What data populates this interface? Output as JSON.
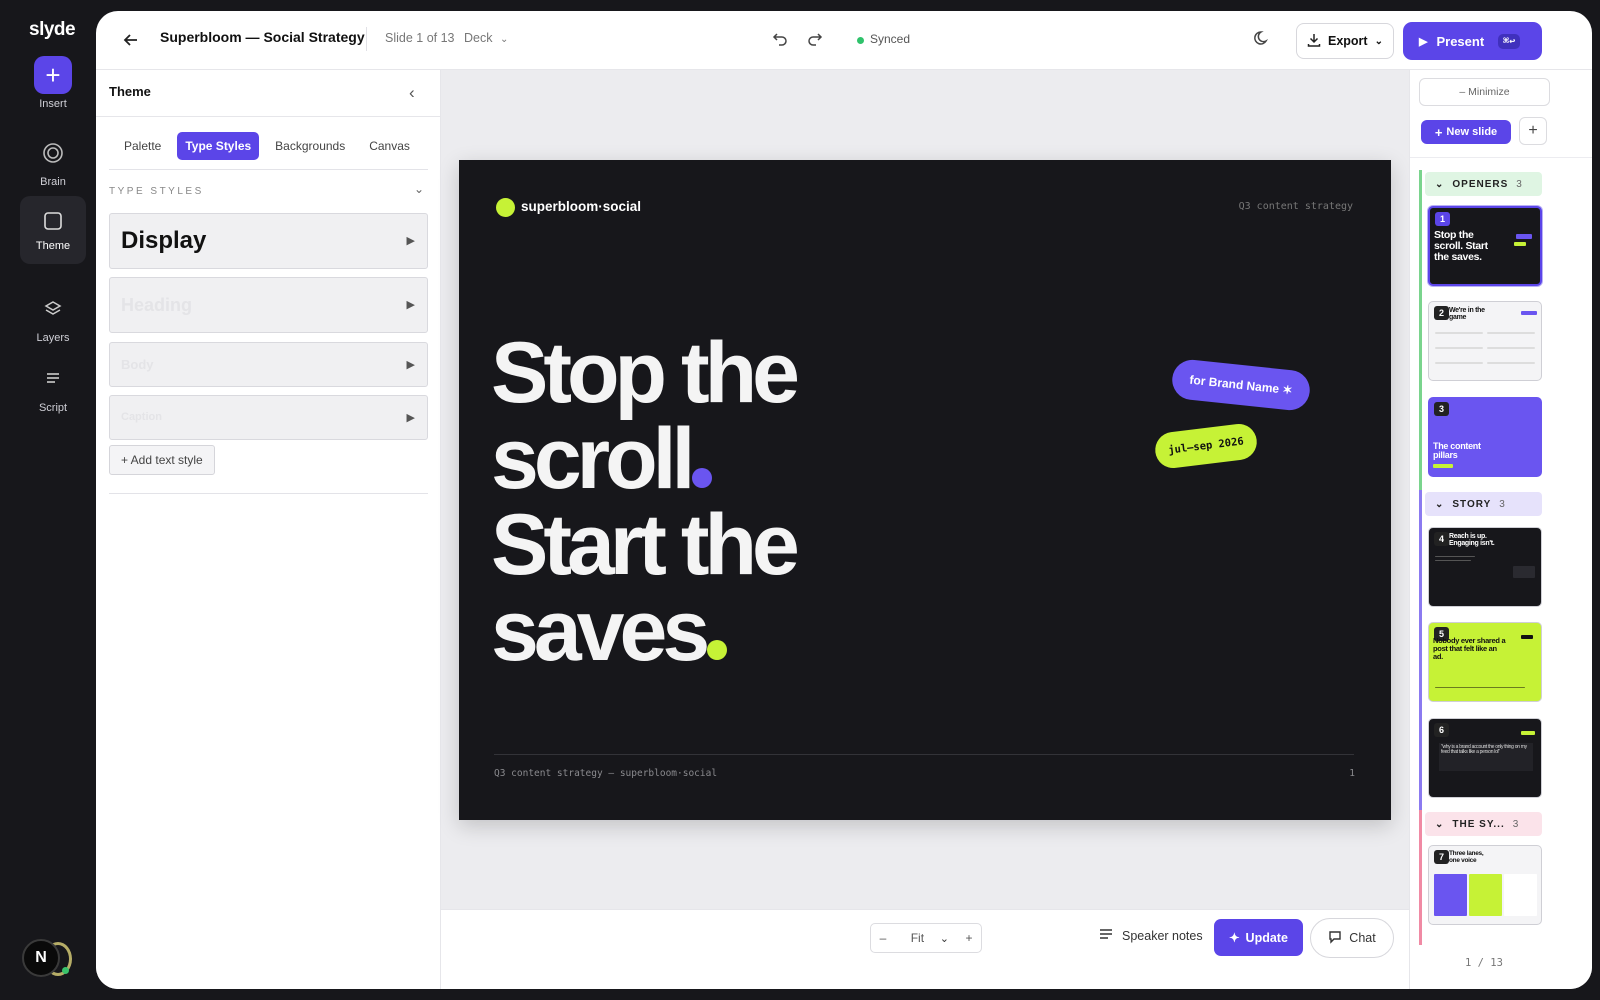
{
  "rail": {
    "logo": "slyde",
    "items": [
      {
        "label": "Insert",
        "icon": "plus-icon"
      },
      {
        "label": "Brain",
        "icon": "brain-icon"
      },
      {
        "label": "Theme",
        "icon": "theme-icon"
      },
      {
        "label": "Layers",
        "icon": "layers-icon"
      },
      {
        "label": "Script",
        "icon": "script-icon"
      }
    ],
    "avatar_initial": "N"
  },
  "topbar": {
    "title": "Superbloom — Social Strategy",
    "slide_count": "Slide 1 of 13",
    "deck_label": "Deck",
    "sync_status": "Synced",
    "export_label": "Export",
    "present_label": "Present",
    "present_shortcut": "⌘↩"
  },
  "theme_panel": {
    "title": "Theme",
    "tabs": [
      "Palette",
      "Type Styles",
      "Backgrounds",
      "Canvas"
    ],
    "active_tab": "Type Styles",
    "section_heading": "TYPE STYLES",
    "type_styles": [
      {
        "name": "Display"
      },
      {
        "name": "Heading"
      },
      {
        "name": "Body"
      },
      {
        "name": "Caption"
      }
    ],
    "add_label": "+ Add text style"
  },
  "slide": {
    "brand": "superbloom·social",
    "tag": "Q3 content strategy",
    "headline": {
      "line1": "Stop the",
      "line2": "scroll",
      "line3": "Start the",
      "line4": "saves"
    },
    "pill_brand": "for Brand Name ✶",
    "pill_date": "jul–sep 2026",
    "footer": "Q3 content strategy — superbloom·social",
    "number": "1"
  },
  "bottombar": {
    "zoom_minus": "–",
    "zoom_label": "Fit",
    "zoom_plus": "+",
    "speaker_notes": "Speaker notes",
    "update_label": "Update",
    "chat_label": "Chat"
  },
  "slide_rail": {
    "minimize_label": "– Minimize",
    "new_slide_label": "New slide",
    "add_label": "+",
    "groups": [
      {
        "name": "OPENERS",
        "count": "3"
      },
      {
        "name": "STORY",
        "count": "3"
      },
      {
        "name": "THE SY...",
        "count": "3"
      }
    ],
    "thumbs": [
      {
        "num": "1",
        "text": "Stop the scroll. Start the saves."
      },
      {
        "num": "2",
        "text": "We're in the game"
      },
      {
        "num": "3",
        "text": "The content pillars"
      },
      {
        "num": "4",
        "text": "Reach is up. Engaging isn't."
      },
      {
        "num": "5",
        "text": "Nobody ever shared a post that felt like an ad."
      },
      {
        "num": "6",
        "text": "\"why is a brand account the only thing on my feed that talks like a person lol\""
      },
      {
        "num": "7",
        "text": "Three lanes, one voice"
      }
    ],
    "page_indicator": "1 / 13"
  },
  "colors": {
    "accent": "#5b45e8",
    "lime": "#c6f236",
    "slide_bg": "#17171b",
    "pill_purple": "#6a55f0",
    "synced": "#2fc26b",
    "group_openers": "#dff5e3",
    "group_story": "#e6e2fb",
    "group_system": "#fbe3ea"
  }
}
